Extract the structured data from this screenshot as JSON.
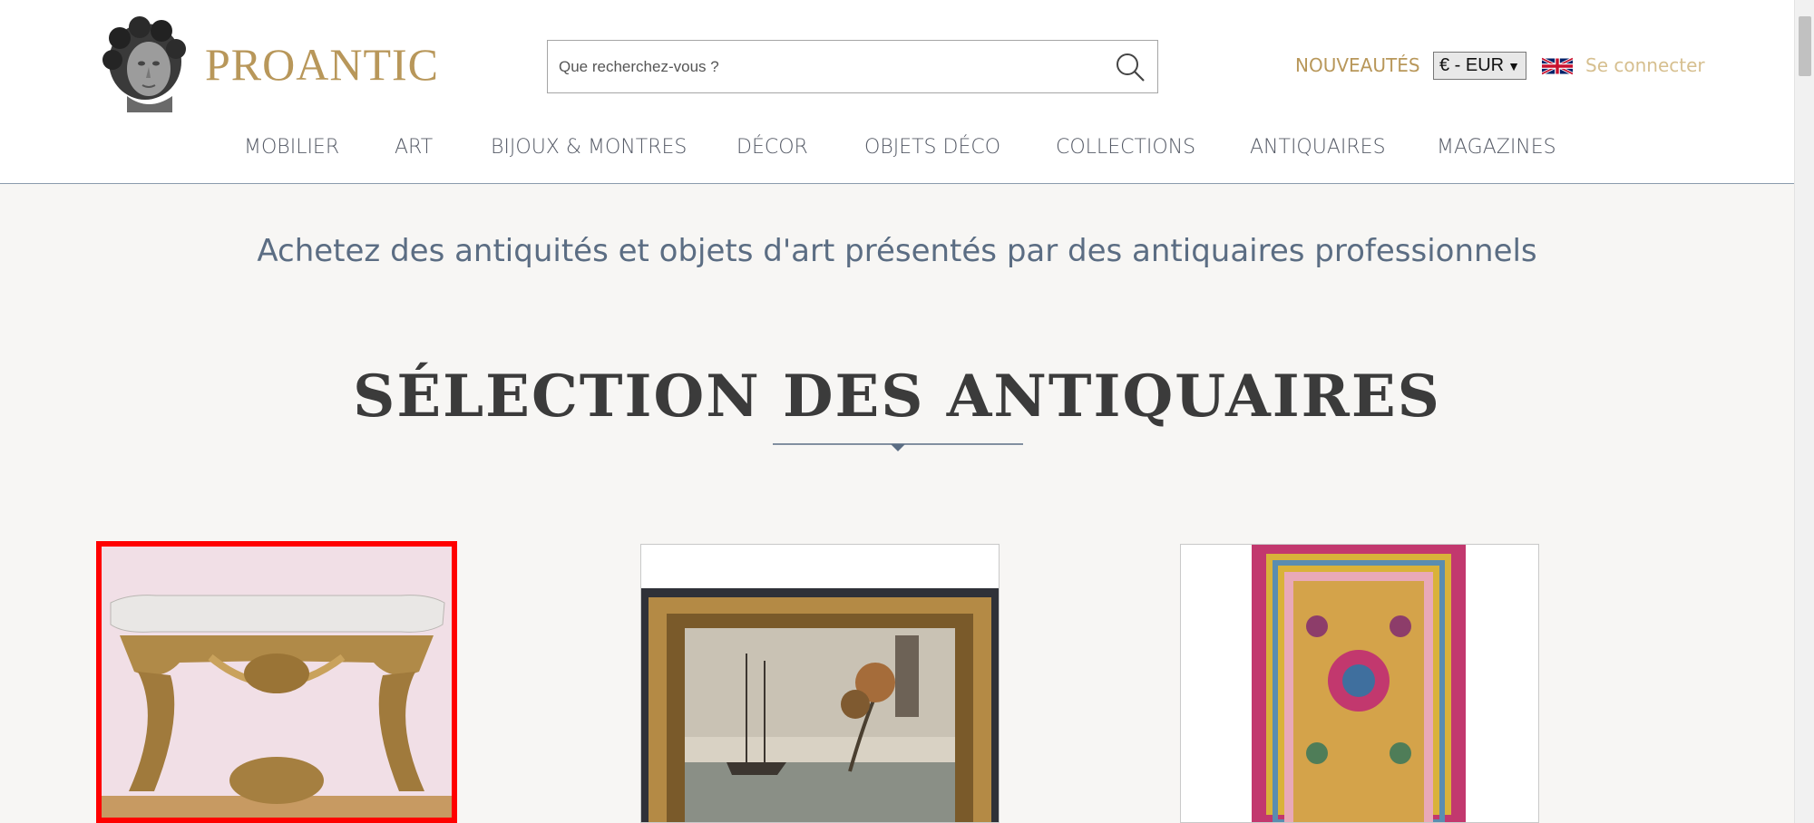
{
  "header": {
    "brand": "PROANTIC",
    "search": {
      "placeholder": "Que recherchez-vous ?",
      "value": ""
    },
    "new_link": "NOUVEAUTÉS",
    "currency": "€ - EUR",
    "language_flag": "uk-flag-icon",
    "login": "Se connecter"
  },
  "nav": {
    "items": [
      {
        "label": "MOBILIER"
      },
      {
        "label": "ART"
      },
      {
        "label": "BIJOUX & MONTRES"
      },
      {
        "label": "DÉCOR"
      },
      {
        "label": "OBJETS DÉCO"
      },
      {
        "label": "COLLECTIONS"
      },
      {
        "label": "ANTIQUAIRES"
      },
      {
        "label": "MAGAZINES"
      }
    ]
  },
  "main": {
    "tagline": "Achetez des antiquités et objets d'art présentés par des antiquaires professionnels",
    "section_title": "SÉLECTION DES ANTIQUAIRES",
    "cards": [
      {
        "image": "marble-top-giltwood-console",
        "selected": true
      },
      {
        "image": "framed-marine-painting",
        "selected": false
      },
      {
        "image": "persian-rug",
        "selected": false
      }
    ]
  },
  "colors": {
    "gold": "#b8975a",
    "light_gold": "#d6bf8f",
    "slate": "#5b6d83",
    "highlight": "#ff0000",
    "background": "#f7f6f4"
  }
}
